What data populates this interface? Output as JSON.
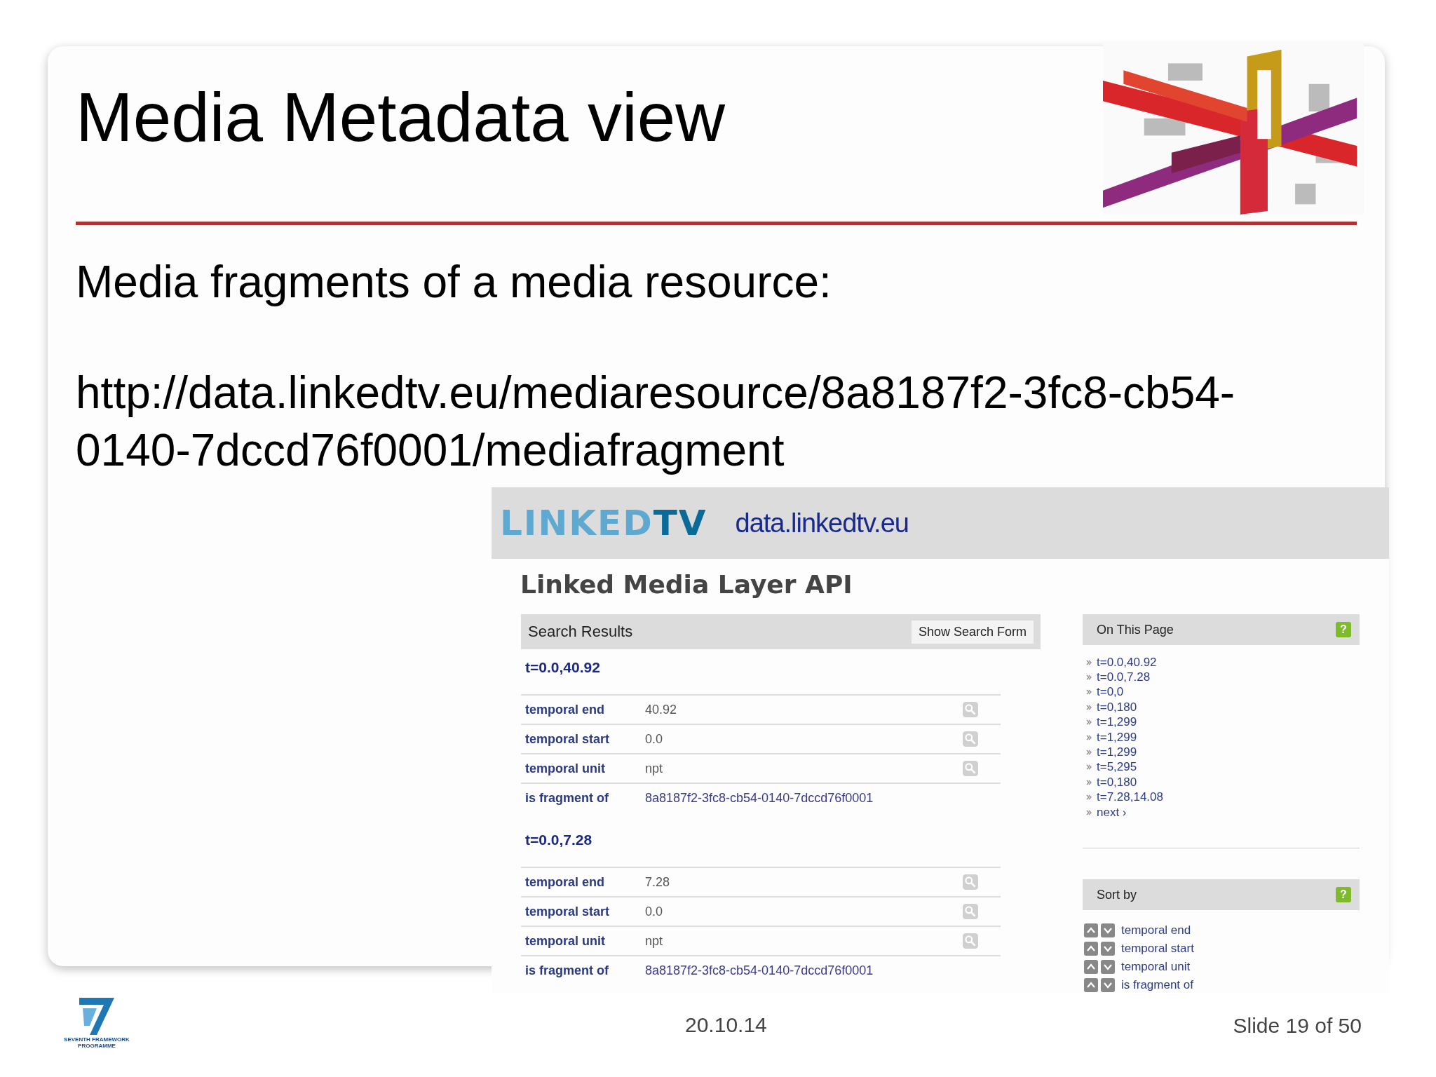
{
  "slide": {
    "title": "Media Metadata view",
    "body": [
      "Media fragments of a media resource:",
      "http://data.linkedtv.eu/mediaresource/8a8187f2-3fc8-cb54-0140-7dccd76f0001/mediafragment"
    ]
  },
  "screenshot": {
    "logo": {
      "part_1": "LINKED",
      "part_2": "TV"
    },
    "site": "data.linkedtv.eu",
    "heading": "Linked Media Layer API",
    "results": {
      "title": "Search Results",
      "button": "Show Search Form",
      "groups": [
        {
          "title": "t=0.0,40.92",
          "rows": [
            {
              "label": "temporal end",
              "value": "40.92",
              "search": true
            },
            {
              "label": "temporal start",
              "value": "0.0",
              "search": true
            },
            {
              "label": "temporal unit",
              "value": "npt",
              "search": true
            },
            {
              "label": "is fragment of",
              "value": "8a8187f2-3fc8-cb54-0140-7dccd76f0001",
              "search": false
            }
          ]
        },
        {
          "title": "t=0.0,7.28",
          "rows": [
            {
              "label": "temporal end",
              "value": "7.28",
              "search": true
            },
            {
              "label": "temporal start",
              "value": "0.0",
              "search": true
            },
            {
              "label": "temporal unit",
              "value": "npt",
              "search": true
            },
            {
              "label": "is fragment of",
              "value": "8a8187f2-3fc8-cb54-0140-7dccd76f0001",
              "search": false
            }
          ]
        }
      ]
    },
    "on_this_page": {
      "title": "On This Page",
      "help": "?",
      "items": [
        "t=0.0,40.92",
        "t=0.0,7.28",
        "t=0,0",
        "t=0,180",
        "t=1,299",
        "t=1,299",
        "t=1,299",
        "t=5,295",
        "t=0,180",
        "t=7.28,14.08",
        "next ›"
      ]
    },
    "sort_by": {
      "title": "Sort by",
      "help": "?",
      "items": [
        "temporal end",
        "temporal start",
        "temporal unit",
        "is fragment of"
      ]
    }
  },
  "footer": {
    "programme": "SEVENTH FRAMEWORK PROGRAMME",
    "date": "20.10.14",
    "slide_number": "Slide 19 of 50"
  }
}
